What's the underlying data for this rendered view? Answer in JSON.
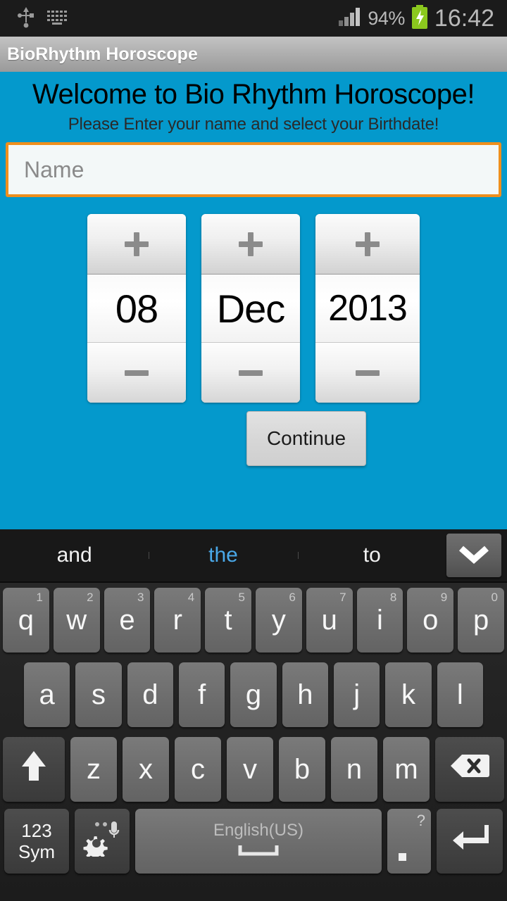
{
  "statusbar": {
    "icons": [
      "usb-icon",
      "keyboard-icon",
      "signal-icon",
      "battery-charging-icon"
    ],
    "battery_percent": "94%",
    "time": "16:42"
  },
  "actionbar": {
    "title": "BioRhythm Horoscope"
  },
  "app": {
    "heading": "Welcome to Bio Rhythm Horoscope!",
    "subtitle": "Please Enter your name and select your Birthdate!",
    "name_field": {
      "value": "",
      "placeholder": "Name"
    },
    "pickers": [
      {
        "name": "day-picker",
        "value": "08",
        "increment": "+",
        "decrement": "–"
      },
      {
        "name": "month-picker",
        "value": "Dec",
        "increment": "+",
        "decrement": "–"
      },
      {
        "name": "year-picker",
        "value": "2013",
        "increment": "+",
        "decrement": "–"
      }
    ],
    "continue_label": "Continue",
    "background_color": "#0499cc",
    "accent_border_color": "#ef8f1c"
  },
  "keyboard": {
    "suggestions": [
      {
        "text": "and",
        "selected": false
      },
      {
        "text": "the",
        "selected": true
      },
      {
        "text": "to",
        "selected": false
      }
    ],
    "expand_icon": "chevron-down-icon",
    "row1": [
      {
        "key": "q",
        "num": "1"
      },
      {
        "key": "w",
        "num": "2"
      },
      {
        "key": "e",
        "num": "3"
      },
      {
        "key": "r",
        "num": "4"
      },
      {
        "key": "t",
        "num": "5"
      },
      {
        "key": "y",
        "num": "6"
      },
      {
        "key": "u",
        "num": "7"
      },
      {
        "key": "i",
        "num": "8"
      },
      {
        "key": "o",
        "num": "9"
      },
      {
        "key": "p",
        "num": "0"
      }
    ],
    "row2": [
      {
        "key": "a"
      },
      {
        "key": "s"
      },
      {
        "key": "d"
      },
      {
        "key": "f"
      },
      {
        "key": "g"
      },
      {
        "key": "h"
      },
      {
        "key": "j"
      },
      {
        "key": "k"
      },
      {
        "key": "l"
      }
    ],
    "row3": [
      {
        "key": "z"
      },
      {
        "key": "x"
      },
      {
        "key": "c"
      },
      {
        "key": "v"
      },
      {
        "key": "b"
      },
      {
        "key": "n"
      },
      {
        "key": "m"
      }
    ],
    "shift_icon": "shift-up-arrow-icon",
    "backspace_icon": "backspace-icon",
    "sym_label_line1": "123",
    "sym_label_line2": "Sym",
    "settings_icon": "gear-microphone-icon",
    "space_label": "English(US)",
    "period_label": ".",
    "period_alt": "?",
    "enter_icon": "enter-return-icon",
    "highlight_color": "#4aa8e8"
  }
}
